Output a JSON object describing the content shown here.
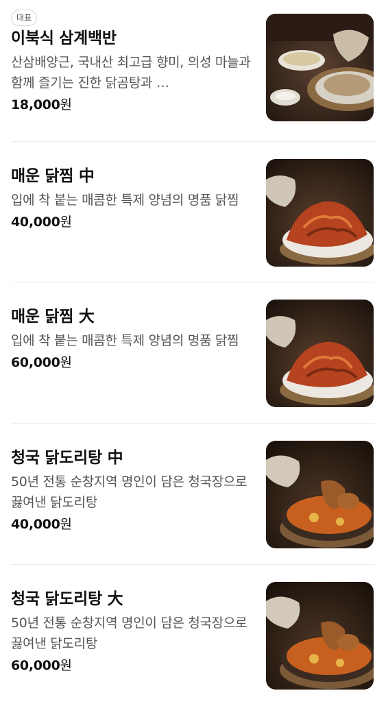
{
  "menu": {
    "items": [
      {
        "badge": "대표",
        "name": "이북식 삼계백반",
        "description": "산삼배양근, 국내산 최고급 향미, 의성 마늘과 함께 즐기는 진한 닭곰탕과 …",
        "price": "18,000",
        "currency": "원",
        "image": "samgye-baekban-photo"
      },
      {
        "name": "매운 닭찜 中",
        "description": "입에 착 붙는 매콤한 특제 양념의 명품 닭찜",
        "price": "40,000",
        "currency": "원",
        "image": "spicy-braised-chicken-photo"
      },
      {
        "name": "매운 닭찜 大",
        "description": "입에 착 붙는 매콤한 특제 양념의 명품 닭찜",
        "price": "60,000",
        "currency": "원",
        "image": "spicy-braised-chicken-photo"
      },
      {
        "name": "청국 닭도리탕 中",
        "description": "50년 전통 순창지역 명인이 담은 청국장으로 끓여낸 닭도리탕",
        "price": "40,000",
        "currency": "원",
        "image": "dakdoritang-photo"
      },
      {
        "name": "청국 닭도리탕 大",
        "description": "50년 전통 순창지역 명인이 담은 청국장으로 끓여낸 닭도리탕",
        "price": "60,000",
        "currency": "원",
        "image": "dakdoritang-photo"
      }
    ]
  },
  "colors": {
    "text": "#111111",
    "description": "#555555",
    "divider": "#ececec"
  }
}
